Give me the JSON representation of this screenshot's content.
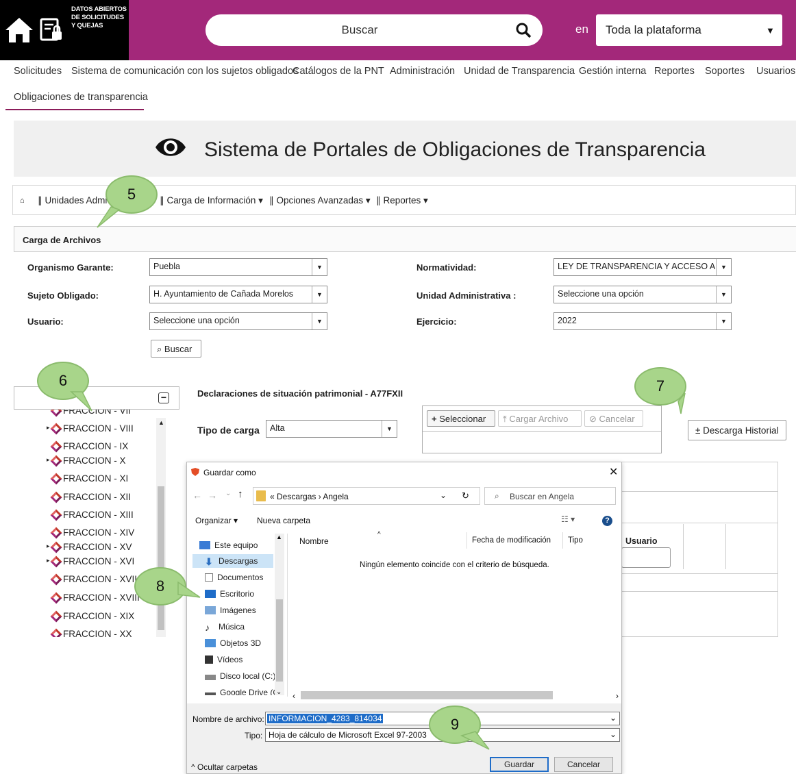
{
  "header": {
    "logo_text": "DATOS ABIERTOS DE SOLICITUDES Y QUEJAS",
    "search_placeholder": "Buscar",
    "scope_prefix": "en",
    "scope_value": "Toda la plataforma",
    "colors": {
      "brand": "#a3287a",
      "logo_bg": "#000000"
    }
  },
  "nav": {
    "items": [
      "Solicitudes",
      "Sistema de comunicación con los sujetos obligados",
      "Catálogos de la PNT",
      "Administración",
      "Unidad de Transparencia",
      "Gestión interna",
      "Reportes",
      "Soportes",
      "Usuarios"
    ],
    "active": "Obligaciones de transparencia"
  },
  "banner": {
    "title": "Sistema de Portales de Obligaciones de Transparencia",
    "icon": "eye-icon"
  },
  "menubar": {
    "items": [
      "Unidades Admi",
      "Carga de Información ▾",
      "Opciones Avanzadas ▾",
      "Reportes ▾"
    ]
  },
  "carga": {
    "title": "Carga de Archivos",
    "fields": {
      "organismo_label": "Organismo Garante:",
      "organismo_value": "Puebla",
      "sujeto_label": "Sujeto Obligado:",
      "sujeto_value": "H. Ayuntamiento de Cañada Morelos",
      "usuario_label": "Usuario:",
      "usuario_value": "Seleccione una opción",
      "normatividad_label": "Normatividad:",
      "normatividad_value": "LEY DE TRANSPARENCIA Y ACCESO A LA II",
      "unidad_label": "Unidad Administrativa :",
      "unidad_value": "Seleccione una opción",
      "ejercicio_label": "Ejercicio:",
      "ejercicio_value": "2022"
    },
    "buscar_button": "⌕ Buscar"
  },
  "tree": {
    "items": [
      "FRACCION - VII",
      "FRACCION - VIII",
      "FRACCION - IX",
      "FRACCION - X",
      "FRACCION - XI",
      "FRACCION - XII",
      "FRACCION - XIII",
      "FRACCION - XIV",
      "FRACCION - XV",
      "FRACCION - XVI",
      "FRACCION - XVII",
      "FRACCION - XVIII",
      "FRACCION - XIX",
      "FRACCION - XX"
    ]
  },
  "panel": {
    "title": "Declaraciones de situación patrimonial - A77FXII",
    "tipo_carga_label": "Tipo de carga",
    "tipo_carga_value": "Alta",
    "seleccionar": "Seleccionar",
    "cargar": "Cargar Archivo",
    "cancelar": "Cancelar",
    "descarga_historial": "± Descarga Historial",
    "usuario_col": "Usuario"
  },
  "callouts": [
    "5",
    "6",
    "7",
    "8",
    "9"
  ],
  "dialog": {
    "title": "Guardar como",
    "path": "« Descargas › Angela",
    "search_placeholder": "Buscar en Angela",
    "organizar": "Organizar ▾",
    "nueva_carpeta": "Nueva carpeta",
    "col_nombre": "Nombre",
    "col_fecha": "Fecha de modificación",
    "col_tipo": "Tipo",
    "empty_message": "Ningún elemento coincide con el criterio de búsqueda.",
    "sidebar": [
      "Este equipo",
      "Descargas",
      "Documentos",
      "Escritorio",
      "Imágenes",
      "Música",
      "Objetos 3D",
      "Vídeos",
      "Disco local (C:)",
      "Google Drive (G:"
    ],
    "filename_label": "Nombre de archivo:",
    "filename_value": "INFORMACION_4283_814034",
    "tipo_label": "Tipo:",
    "tipo_value": "Hoja de cálculo de Microsoft Excel 97-2003",
    "hide_folders": "Ocultar carpetas",
    "guardar": "Guardar",
    "cancelar": "Cancelar"
  }
}
